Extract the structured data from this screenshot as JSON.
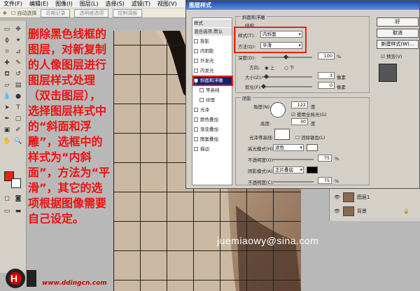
{
  "menubar": {
    "items": [
      "文件(F)",
      "编辑(E)",
      "图像(I)",
      "图层(L)",
      "选择(S)",
      "滤镜(T)",
      "视图(V)"
    ]
  },
  "optionsbar": {
    "auto_select": "自动选择",
    "btn1": "近期记录",
    "btn2": "透明度选项",
    "btn3": "控制调板"
  },
  "instruction": "删除黑色线框的图层，对新复制的人像图层进行图层样式处理（双击图层），选择图层样式中的“斜面和浮雕”，选框中的样式为“内斜面”，方法为“平滑”，其它的选项根据图像需要自己设定。",
  "dialog": {
    "title": "图层样式",
    "styles_list": {
      "header": "样式",
      "blend": "混合选项:默认",
      "items": [
        "投影",
        "内阴影",
        "外发光",
        "内发光",
        "斜面和浮雕",
        "等高线",
        "纹理",
        "光泽",
        "颜色叠加",
        "渐变叠加",
        "图案叠加",
        "描边"
      ],
      "checked_index": 4
    },
    "bevel_section": "斜面和浮雕",
    "structure": "结构",
    "style_label": "样式(T):",
    "style_value": "内斜面",
    "technique_label": "方法(Q):",
    "technique_value": "平滑",
    "depth_label": "深度(D):",
    "depth_value": "100",
    "depth_unit": "%",
    "direction_label": "方向:",
    "direction_up": "上",
    "direction_down": "下",
    "size_label": "大小(Z):",
    "size_value": "3",
    "size_unit": "像素",
    "soften_label": "软化(F):",
    "soften_value": "0",
    "soften_unit": "像素",
    "shading": "阴影",
    "angle_label": "角度(N):",
    "angle_value": "122",
    "angle_unit": "度",
    "global_light": "使用全局光(G)",
    "altitude_label": "高度:",
    "altitude_value": "30",
    "altitude_unit": "度",
    "gloss_label": "光泽等高线:",
    "anti_alias": "消除锯齿(L)",
    "highlight_label": "高光模式(H):",
    "highlight_value": "滤色",
    "opacity1_label": "不透明度(O):",
    "opacity1_value": "75",
    "opacity_unit": "%",
    "shadow_label": "阴影模式(A):",
    "shadow_value": "正片叠底",
    "opacity2_label": "不透明度(C):",
    "opacity2_value": "75",
    "ok": "好",
    "cancel": "取消",
    "new_style": "新建样式(W)...",
    "preview": "预览(V)"
  },
  "layers": {
    "rows": [
      "图层1",
      "背景"
    ]
  },
  "watermark": "juemiaowy@sina.com",
  "logo_text": "www.ddingcn.com",
  "colors": {
    "accent_red": "#e21f1f",
    "dialog_title": "#1c4aa8",
    "dialog_bg": "#d4d0c8"
  }
}
